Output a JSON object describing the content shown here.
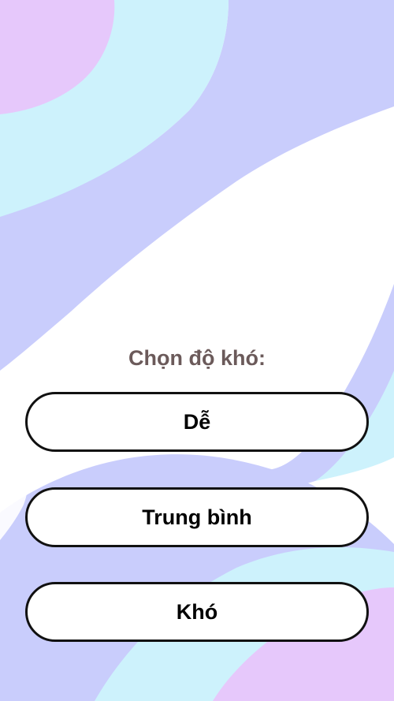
{
  "prompt": "Chọn độ khó:",
  "options": [
    {
      "label": "Dễ"
    },
    {
      "label": "Trung bình"
    },
    {
      "label": "Khó"
    }
  ],
  "colors": {
    "lavender": "#c9cdfc",
    "light_cyan": "#cdf2fc",
    "pink_lilac": "#e6c8fb",
    "prompt_text": "#6b5a5a",
    "button_border": "#111111",
    "button_fill": "#ffffff"
  }
}
